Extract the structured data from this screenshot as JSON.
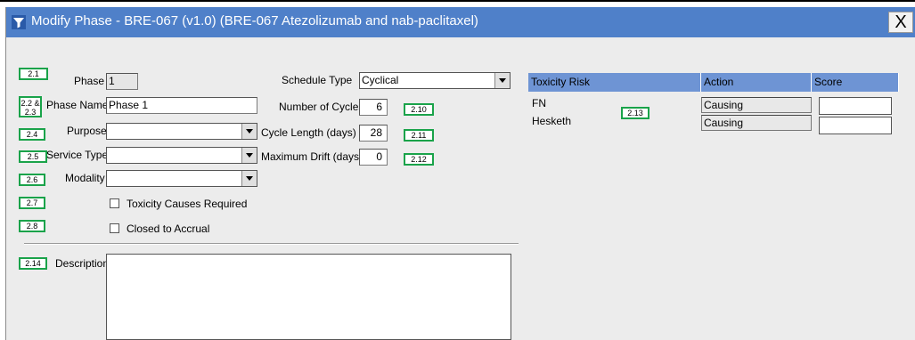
{
  "window": {
    "title": "Modify Phase - BRE-067 (v1.0) (BRE-067 Atezolizumab and nab-paclitaxel)",
    "close_label": "X"
  },
  "form": {
    "phase_label": "Phase",
    "phase_value": "1",
    "phase_name_label": "Phase Name",
    "phase_name_value": "Phase 1",
    "purpose_label": "Purpose",
    "purpose_value": "",
    "service_type_label": "Service Type",
    "service_type_value": "",
    "modality_label": "Modality",
    "modality_value": "",
    "toxicity_causes_label": "Toxicity Causes Required",
    "toxicity_causes_checked": false,
    "closed_accrual_label": "Closed to Accrual",
    "closed_accrual_checked": false,
    "description_label": "Description",
    "description_value": ""
  },
  "schedule": {
    "schedule_type_label": "Schedule Type",
    "schedule_type_value": "Cyclical",
    "num_cycles_label": "Number of Cycles",
    "num_cycles_value": "6",
    "cycle_length_label": "Cycle Length (days)",
    "cycle_length_value": "28",
    "max_drift_label": "Maximum Drift (days)",
    "max_drift_value": "0"
  },
  "toxicity_grid": {
    "headers": [
      "Toxicity Risk",
      "Action",
      "Score"
    ],
    "rows": [
      {
        "risk": "FN",
        "action": "Causing",
        "score": ""
      },
      {
        "risk": "Hesketh",
        "action": "Causing",
        "score": ""
      }
    ]
  },
  "annotations": {
    "a2_1": "2.1",
    "a2_2_line1": "2.2 &",
    "a2_2_line2": "2.3",
    "a2_4": "2.4",
    "a2_5": "2.5",
    "a2_6": "2.6",
    "a2_7": "2.7",
    "a2_8": "2.8",
    "a2_10": "2.10",
    "a2_11": "2.11",
    "a2_12": "2.12",
    "a2_13": "2.13",
    "a2_14": "2.14"
  },
  "colors": {
    "titlebar": "#4f80c9",
    "grid_header": "#6e94d4",
    "annotation_border": "#1aa34a"
  }
}
